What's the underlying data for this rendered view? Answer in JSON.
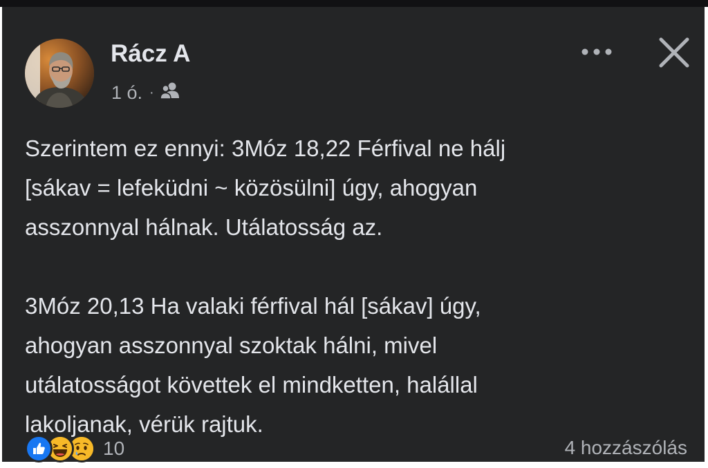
{
  "post": {
    "author": "Rácz A",
    "time": "1 ó.",
    "separator": "·",
    "audience_icon": "friends-icon",
    "paragraphs": [
      [
        "Szerintem ez ennyi: 3Móz 18,22 Férfival ne hálj",
        "[sákav = lefeküdni ~ közösülni] úgy, ahogyan",
        "asszonnyal hálnak. Utálatosság az."
      ],
      [
        "3Móz 20,13 Ha valaki férfival hál [sákav] úgy,",
        "ahogyan asszonnyal szoktak hálni, mivel",
        "utálatosságot követtek el mindketten, halállal",
        "lakoljanak, vérük rajtuk."
      ]
    ]
  },
  "actions": {
    "more_icon": "more-options-icon",
    "close_icon": "close-icon"
  },
  "footer": {
    "reactions": [
      "like-icon",
      "haha-icon",
      "sad-icon"
    ],
    "reaction_count": "10",
    "comments": "4 hozzászólás"
  },
  "colors": {
    "card_background": "#242526",
    "primary_text": "#e4e6eb",
    "secondary_text": "#b0b3b8",
    "like_blue": "#1877f2",
    "emoji_yellow": "#f7b928"
  }
}
